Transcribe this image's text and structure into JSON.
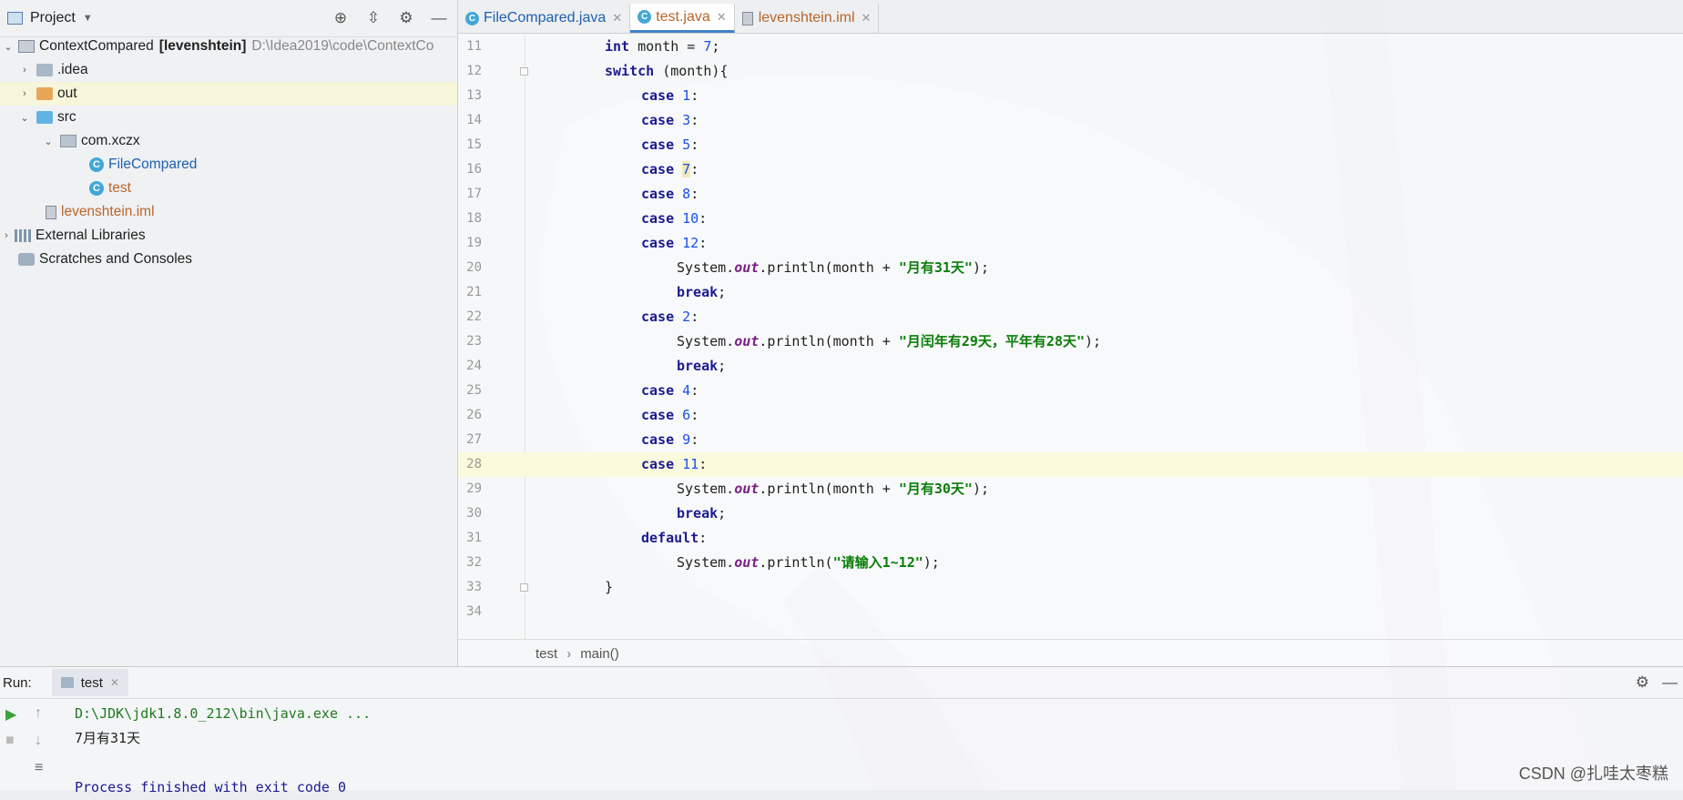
{
  "project_panel": {
    "title": "Project",
    "tree": [
      {
        "label": "ContextCompared",
        "suffix": "[levenshtein]",
        "path": "D:\\Idea2019\\code\\ContextCo"
      },
      {
        "label": ".idea"
      },
      {
        "label": "out"
      },
      {
        "label": "src"
      },
      {
        "label": "com.xczx"
      },
      {
        "label": "FileCompared"
      },
      {
        "label": "test"
      },
      {
        "label": "levenshtein.iml"
      },
      {
        "label": "External Libraries"
      },
      {
        "label": "Scratches and Consoles"
      }
    ],
    "icons": {
      "locate": "crosshair-icon",
      "collapse": "collapse-icon",
      "settings": "gear-icon",
      "hide": "minimize-icon"
    }
  },
  "editor": {
    "tabs": [
      {
        "label": "FileCompared.java"
      },
      {
        "label": "test.java",
        "active": true
      },
      {
        "label": "levenshtein.iml"
      }
    ],
    "line_numbers": [
      "11",
      "12",
      "13",
      "14",
      "15",
      "16",
      "17",
      "18",
      "19",
      "20",
      "21",
      "22",
      "23",
      "24",
      "25",
      "26",
      "27",
      "28",
      "29",
      "30",
      "31",
      "32",
      "33",
      "34"
    ],
    "current_line": "28",
    "breadcrumb": [
      "test",
      "main()"
    ]
  },
  "code": {
    "l11": [
      "int",
      " month = ",
      "7",
      ";"
    ],
    "l12": [
      "switch",
      " (month){"
    ],
    "l13": [
      "case",
      "1",
      ":"
    ],
    "l14": [
      "case",
      "3",
      ":"
    ],
    "l15": [
      "case",
      "5",
      ":"
    ],
    "l16": [
      "case",
      "7",
      ":"
    ],
    "l17": [
      "case",
      "8",
      ":"
    ],
    "l18": [
      "case",
      "10",
      ":"
    ],
    "l19": [
      "case",
      "12",
      ":"
    ],
    "l20": [
      "System.",
      "out",
      ".println(month + ",
      "\"月有31天\"",
      ");"
    ],
    "l21": [
      "break",
      ";"
    ],
    "l22": [
      "case",
      "2",
      ":"
    ],
    "l23": [
      "System.",
      "out",
      ".println(month + ",
      "\"月闰年有29天，平年有28天\"",
      ");"
    ],
    "l24": [
      "break",
      ";"
    ],
    "l25": [
      "case",
      "4",
      ":"
    ],
    "l26": [
      "case",
      "6",
      ":"
    ],
    "l27": [
      "case",
      "9",
      ":"
    ],
    "l28": [
      "case",
      "11",
      ":"
    ],
    "l29": [
      "System.",
      "out",
      ".println(month + ",
      "\"月有30天\"",
      ");"
    ],
    "l30": [
      "break",
      ";"
    ],
    "l31": [
      "default",
      ":"
    ],
    "l32": [
      "System.",
      "out",
      ".println(",
      "\"请输入1~12\"",
      ");"
    ],
    "l33": [
      "}"
    ]
  },
  "run": {
    "label": "Run:",
    "tab": "test",
    "console": [
      "D:\\JDK\\jdk1.8.0_212\\bin\\java.exe ...",
      "7月有31天",
      "",
      "Process finished with exit code 0"
    ]
  },
  "watermark": "CSDN @扎哇太枣糕"
}
